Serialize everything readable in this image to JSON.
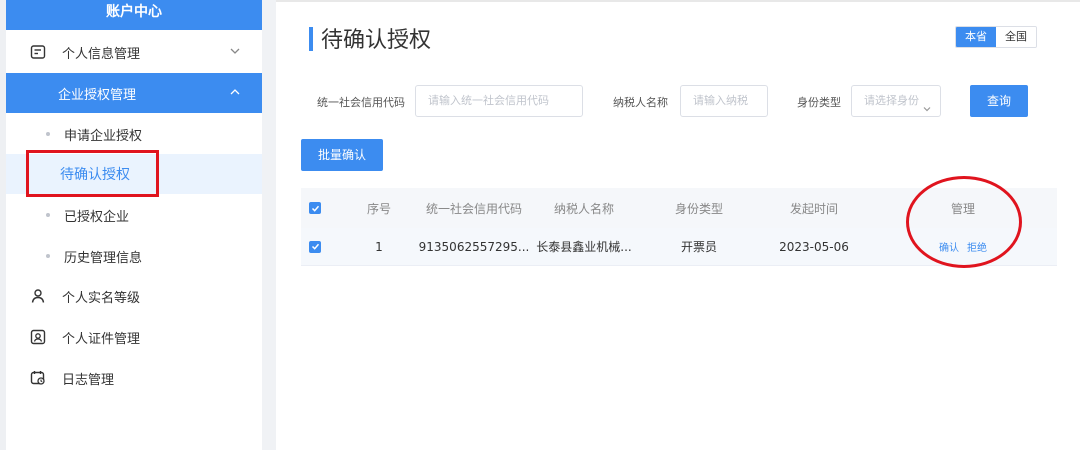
{
  "colors": {
    "primary": "#3c8cf0",
    "highlight": "#e0141e",
    "header_bg": "#f5f7fa"
  },
  "sidebar": {
    "header": "账户中心",
    "items": [
      {
        "label": "个人信息管理",
        "icon": "profile-card-icon"
      },
      {
        "label": "企业授权管理",
        "icon": ""
      },
      {
        "label": "个人实名等级",
        "icon": "user-level-icon"
      },
      {
        "label": "个人证件管理",
        "icon": "id-card-icon"
      },
      {
        "label": "日志管理",
        "icon": "log-calendar-icon"
      }
    ],
    "subitems": [
      {
        "label": "申请企业授权"
      },
      {
        "label": "待确认授权"
      },
      {
        "label": "已授权企业"
      },
      {
        "label": "历史管理信息"
      }
    ]
  },
  "main": {
    "title": "待确认授权",
    "scope": {
      "options": [
        "本省",
        "全国"
      ],
      "selected": "本省"
    },
    "filters": {
      "credit_code": {
        "label": "统一社会信用代码",
        "placeholder": "请输入统一社会信用代码"
      },
      "taxpayer_name": {
        "label": "纳税人名称",
        "placeholder": "请输入纳税"
      },
      "identity_type": {
        "label": "身份类型",
        "placeholder": "请选择身份"
      },
      "query_label": "查询"
    },
    "batch_confirm_label": "批量确认",
    "table": {
      "headers": [
        "序号",
        "统一社会信用代码",
        "纳税人名称",
        "身份类型",
        "发起时间",
        "管理"
      ],
      "rows": [
        {
          "index": "1",
          "credit_code": "9135062557295...",
          "taxpayer_name": "长泰县鑫业机械...",
          "identity_type": "开票员",
          "date": "2023-05-06",
          "confirm_label": "确认",
          "reject_label": "拒绝"
        }
      ]
    }
  }
}
